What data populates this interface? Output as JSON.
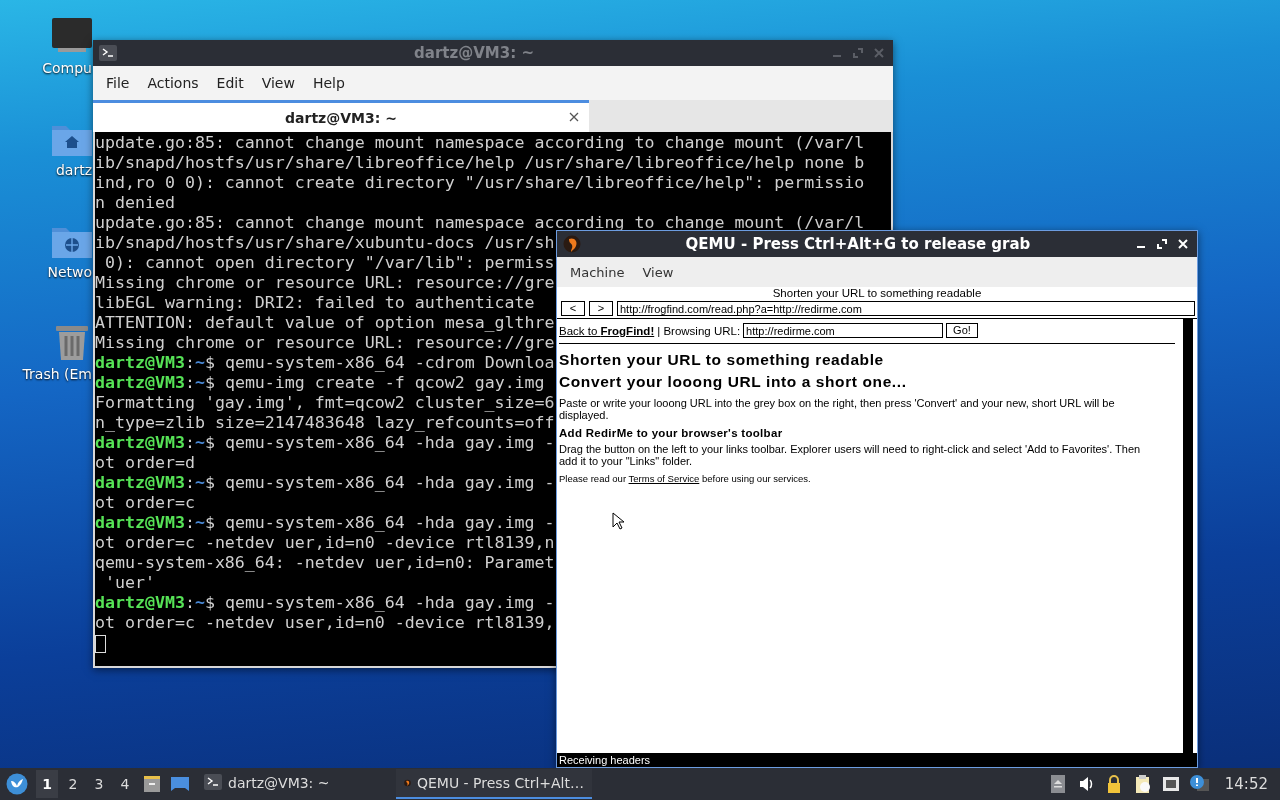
{
  "desktop_icons": [
    {
      "kind": "computer",
      "label": "Compu"
    },
    {
      "kind": "home",
      "label": "dartz"
    },
    {
      "kind": "network",
      "label": "Netwo"
    },
    {
      "kind": "trash",
      "label": "Trash (Em"
    }
  ],
  "terminal_window": {
    "title": "dartz@VM3: ~",
    "menu": [
      "File",
      "Actions",
      "Edit",
      "View",
      "Help"
    ],
    "tabs": [
      {
        "label": "dartz@VM3: ~",
        "selected": true
      }
    ],
    "lines": [
      {
        "kind": "output",
        "text": "update.go:85: cannot change mount namespace according to change mount (/var/l"
      },
      {
        "kind": "output",
        "text": "ib/snapd/hostfs/usr/share/libreoffice/help /usr/share/libreoffice/help none b"
      },
      {
        "kind": "output",
        "text": "ind,ro 0 0): cannot create directory \"/usr/share/libreoffice/help\": permissio"
      },
      {
        "kind": "output",
        "text": "n denied"
      },
      {
        "kind": "output",
        "text": "update.go:85: cannot change mount namespace according to change mount (/var/l"
      },
      {
        "kind": "output",
        "text": "ib/snapd/hostfs/usr/share/xubuntu-docs /usr/sh"
      },
      {
        "kind": "output",
        "text": " 0): cannot open directory \"/var/lib\": permiss"
      },
      {
        "kind": "output",
        "text": "Missing chrome or resource URL: resource://gre"
      },
      {
        "kind": "output",
        "text": "libEGL warning: DRI2: failed to authenticate"
      },
      {
        "kind": "output",
        "text": "ATTENTION: default value of option mesa_glthre"
      },
      {
        "kind": "output",
        "text": "Missing chrome or resource URL: resource://gre"
      },
      {
        "kind": "prompt",
        "user": "dartz@VM3",
        "sep": ":",
        "dir": "~",
        "text": "$ qemu-system-x86_64 -cdrom Downloa"
      },
      {
        "kind": "prompt",
        "user": "dartz@VM3",
        "sep": ":",
        "dir": "~",
        "text": "$ qemu-img create -f qcow2 gay.img"
      },
      {
        "kind": "output",
        "text": "Formatting 'gay.img', fmt=qcow2 cluster_size=6"
      },
      {
        "kind": "output",
        "text": "n_type=zlib size=2147483648 lazy_refcounts=off"
      },
      {
        "kind": "prompt",
        "user": "dartz@VM3",
        "sep": ":",
        "dir": "~",
        "text": "$ qemu-system-x86_64 -hda gay.img -"
      },
      {
        "kind": "output",
        "text": "ot order=d"
      },
      {
        "kind": "prompt",
        "user": "dartz@VM3",
        "sep": ":",
        "dir": "~",
        "text": "$ qemu-system-x86_64 -hda gay.img -"
      },
      {
        "kind": "output",
        "text": "ot order=c"
      },
      {
        "kind": "prompt",
        "user": "dartz@VM3",
        "sep": ":",
        "dir": "~",
        "text": "$ qemu-system-x86_64 -hda gay.img -"
      },
      {
        "kind": "output",
        "text": "ot order=c -netdev uer,id=n0 -device rtl8139,n"
      },
      {
        "kind": "output",
        "text": "qemu-system-x86_64: -netdev uer,id=n0: Paramet"
      },
      {
        "kind": "output",
        "text": " 'uer'"
      },
      {
        "kind": "prompt",
        "user": "dartz@VM3",
        "sep": ":",
        "dir": "~",
        "text": "$ qemu-system-x86_64 -hda gay.img -"
      },
      {
        "kind": "output",
        "text": "ot order=c -netdev user,id=n0 -device rtl8139,"
      },
      {
        "kind": "cursor"
      }
    ]
  },
  "qemu_window": {
    "title": "QEMU - Press Ctrl+Alt+G to release grab",
    "menu": [
      "Machine",
      "View"
    ],
    "guest_browser": {
      "page_title": "Shorten your URL to something readable",
      "back": "<",
      "forward": ">",
      "address": "http://frogfind.com/read.php?a=http://redirme.com",
      "back_link": "Back to **FrogFind!**",
      "separator": "| Browsing URL:",
      "url_field": "http://redirme.com",
      "go_button": "Go!",
      "heading": "Shorten your URL to something readable",
      "subheading": "Convert your looong URL into a short one...",
      "intro": "Paste or write your looong URL into the grey box on the right, then press 'Convert' and your new, short URL will be displayed.",
      "section_title": "Add RedirMe to your browser's toolbar",
      "section_text": "Drag the button on the left to your links toolbar. Explorer users will need to right-click and select 'Add to Favorites'. Then add it to your \"Links\" folder.",
      "notice": {
        "before": "Please read our ",
        "link": "Terms of Service",
        "after": " before using our services."
      },
      "status": "Receiving headers"
    }
  },
  "taskbar": {
    "workspaces": [
      {
        "label": "1",
        "selected": true
      },
      {
        "label": "2",
        "selected": false
      },
      {
        "label": "3",
        "selected": false
      },
      {
        "label": "4",
        "selected": false
      }
    ],
    "tasks": [
      {
        "kind": "terminal",
        "label": "dartz@VM3: ~",
        "selected": false
      },
      {
        "kind": "qemu",
        "label": "QEMU - Press Ctrl+Alt…",
        "selected": true
      }
    ],
    "clock": "14:52"
  }
}
